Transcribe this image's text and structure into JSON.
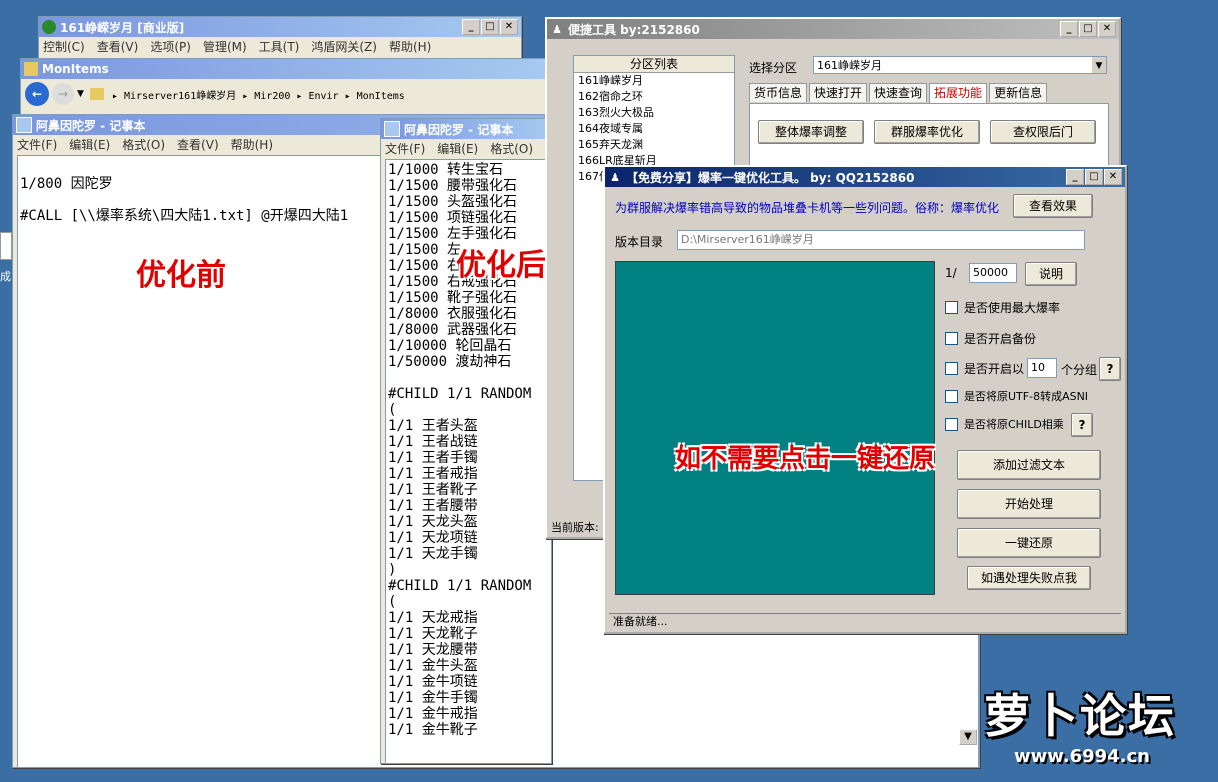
{
  "desktop": {
    "icon_label": "成"
  },
  "explorer_back": {
    "title": "161峥嵘岁月 [商业版]",
    "menu": [
      "控制(C)",
      "查看(V)",
      "选项(P)",
      "管理(M)",
      "工具(T)",
      "鸿盾网关(Z)",
      "帮助(H)"
    ]
  },
  "folder_window": {
    "title": "MonItems",
    "address": "▸ Mirserver161峥嵘岁月 ▸ Mir200 ▸ Envir ▸ MonItems"
  },
  "notepad_left": {
    "title": "阿鼻因陀罗 - 记事本",
    "menu": [
      "文件(F)",
      "编辑(E)",
      "格式(O)",
      "查看(V)",
      "帮助(H)"
    ],
    "lines": [
      "",
      "1/800 因陀罗",
      "",
      "#CALL [\\\\爆率系统\\四大陆1.txt] @开爆四大陆1"
    ],
    "overlay": "优化前"
  },
  "notepad_right": {
    "title": "阿鼻因陀罗 - 记事本",
    "menu": [
      "文件(F)",
      "编辑(E)",
      "格式(O)"
    ],
    "lines": [
      "1/1000 转生宝石",
      "1/1500 腰带强化石",
      "1/1500 头盔强化石",
      "1/1500 项链强化石",
      "1/1500 左手强化石",
      "1/1500 左",
      "1/1500 右",
      "1/1500 右戒强化石",
      "1/1500 靴子强化石",
      "1/8000 衣服强化石",
      "1/8000 武器强化石",
      "1/10000 轮回晶石",
      "1/50000 渡劫神石",
      "",
      "#CHILD 1/1 RANDOM",
      "(",
      "1/1 王者头盔",
      "1/1 王者战链",
      "1/1 王者手镯",
      "1/1 王者戒指",
      "1/1 王者靴子",
      "1/1 王者腰带",
      "1/1 天龙头盔",
      "1/1 天龙项链",
      "1/1 天龙手镯",
      ")",
      "#CHILD 1/1 RANDOM",
      "(",
      "1/1 天龙戒指",
      "1/1 天龙靴子",
      "1/1 天龙腰带",
      "1/1 金牛头盔",
      "1/1 金牛项链",
      "1/1 金牛手镯",
      "1/1 金牛戒指",
      "1/1 金牛靴子"
    ],
    "overlay": "优化后"
  },
  "quick_tool": {
    "title": "便捷工具  by:2152860",
    "list_header": "分区列表",
    "list_items": [
      "161峥嵘岁月",
      "162宿命之环",
      "163烈火大极品",
      "164夜域专属",
      "165弃天龙渊",
      "166LR底星斩月",
      "167仙"
    ],
    "select_label": "选择分区",
    "select_value": "161峥嵘岁月",
    "tabs": [
      "货币信息",
      "快速打开",
      "快速查询",
      "拓展功能",
      "更新信息"
    ],
    "active_tab": "拓展功能",
    "buttons": [
      "整体爆率调整",
      "群服爆率优化",
      "查权限后门"
    ],
    "status": "当前版本:"
  },
  "optimizer": {
    "title": "【免费分享】爆率一键优化工具。   by: QQ2152860",
    "description": "为群服解决爆率错高导致的物品堆叠卡机等一些列问题。俗称：爆率优化",
    "view_effect": "查看效果",
    "dir_label": "版本目录",
    "dir_value": "D:\\Mirserver161峥嵘岁月",
    "rate_prefix": "1/",
    "rate_value": "50000",
    "explain": "说明",
    "opt_max": "是否使用最大爆率",
    "opt_backup": "是否开启备份",
    "opt_group_pre": "是否开启以",
    "group_value": "10",
    "opt_group_post": "个分组",
    "opt_utf8": "是否将原UTF-8转成ASNI",
    "opt_child": "是否将原CHILD相乘",
    "help": "?",
    "add_filter": "添加过滤文本",
    "start": "开始处理",
    "restore": "一键还原",
    "fail": "如遇处理失败点我",
    "overlay": "如不需要点击一键还原",
    "status": "准备就绪..."
  },
  "watermark": {
    "logo": "萝卜论坛",
    "url": "www.6994.cn"
  },
  "colors": {
    "teal_panel": "#008080",
    "title_active": "#0a246a",
    "overlay_red": "#e00000"
  }
}
